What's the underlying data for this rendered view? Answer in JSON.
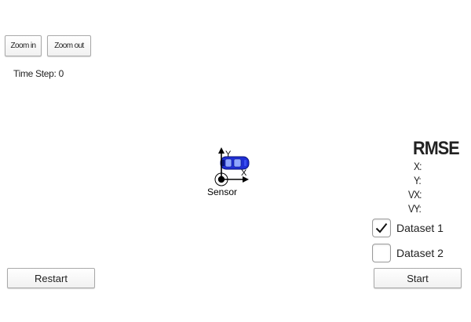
{
  "toolbar": {
    "zoom_in_label": "Zoom in",
    "zoom_out_label": "Zoom out"
  },
  "status": {
    "time_step_label": "Time Step: 0"
  },
  "scene": {
    "axis_x_label": "X",
    "axis_y_label": "Y",
    "sensor_label": "Sensor",
    "car_color": "#1f2fd6",
    "icons": [
      "car-icon",
      "sensor-icon",
      "axis-arrows"
    ]
  },
  "rmse": {
    "title": "RMSE",
    "x_label": "X:",
    "y_label": "Y:",
    "vx_label": "VX:",
    "vy_label": "VY:"
  },
  "datasets": [
    {
      "label": "Dataset 1",
      "checked": true
    },
    {
      "label": "Dataset 2",
      "checked": false
    }
  ],
  "controls": {
    "restart_label": "Restart",
    "start_label": "Start"
  }
}
